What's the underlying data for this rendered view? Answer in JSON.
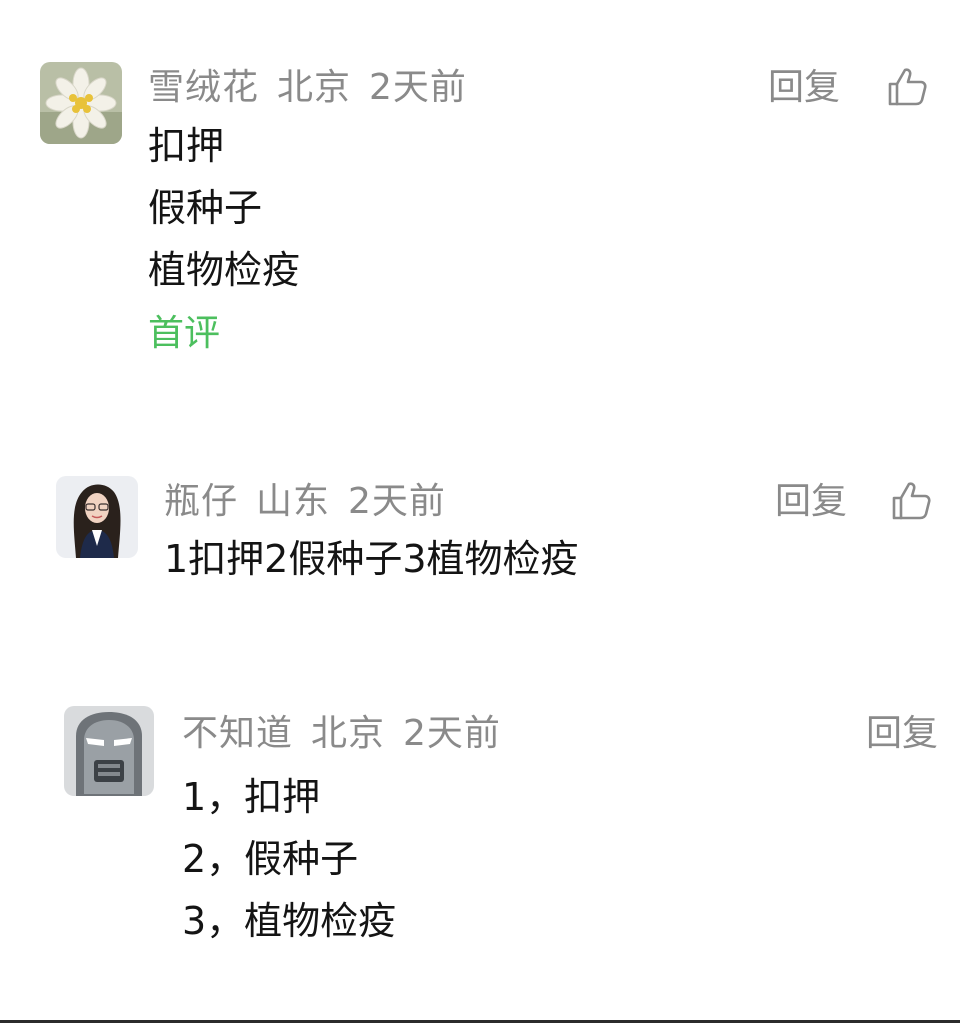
{
  "comments": [
    {
      "avatar_icon": "edelweiss-flower-avatar",
      "username": "雪绒花",
      "location": "北京",
      "time": "2天前",
      "reply_label": "回复",
      "lines": [
        "扣押",
        "假种子",
        "植物检疫"
      ],
      "tag": "首评",
      "tag_color": "#4cbf5e"
    },
    {
      "avatar_icon": "woman-portrait-avatar",
      "username": "瓶仔",
      "location": "山东",
      "time": "2天前",
      "reply_label": "回复",
      "lines": [
        "1扣押2假种子3植物检疫"
      ]
    },
    {
      "avatar_icon": "robot-helmet-avatar",
      "username": "不知道",
      "location": "北京",
      "time": "2天前",
      "reply_label": "回复",
      "lines": [
        "1，扣押",
        "2，假种子",
        "3，植物检疫"
      ]
    }
  ],
  "colors": {
    "meta": "#8a8a8a",
    "text": "#141414",
    "accent": "#4cbf5e"
  }
}
